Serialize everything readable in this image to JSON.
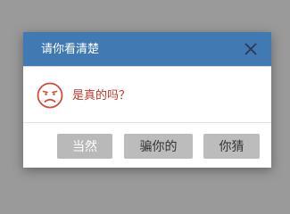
{
  "dialog": {
    "title": "请你看清楚",
    "close_icon": "close-icon",
    "face_icon": "sad-face-icon",
    "message": "是真的吗？",
    "buttons": [
      "当然",
      "骗你的",
      "你猜"
    ],
    "colors": {
      "header": "#4179b2",
      "message": "#c0392b",
      "button": "#bcbcbc"
    }
  }
}
